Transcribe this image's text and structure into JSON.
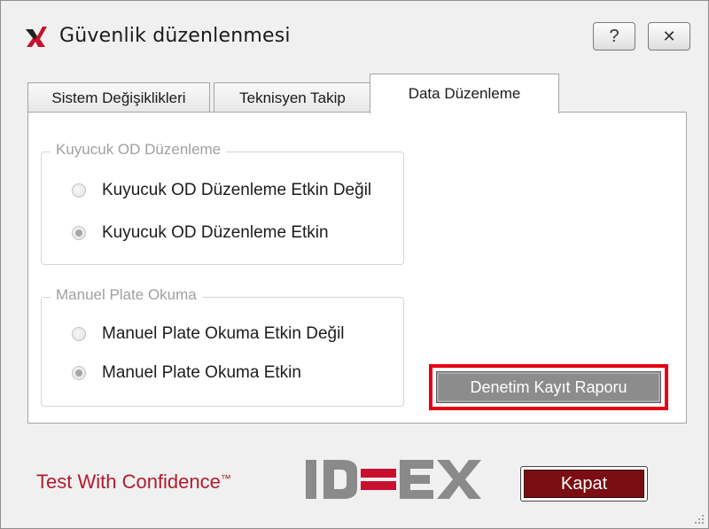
{
  "window": {
    "title": "Güvenlik düzenlenmesi",
    "help_label": "?",
    "close_label": "✕"
  },
  "tabs": [
    {
      "label": "Sistem Değişiklikleri",
      "active": false
    },
    {
      "label": "Teknisyen Takip",
      "active": false
    },
    {
      "label": "Data Düzenleme",
      "active": true
    }
  ],
  "groups": [
    {
      "title": "Kuyucuk OD Düzenleme",
      "options": [
        {
          "label": "Kuyucuk OD Düzenleme Etkin Değil",
          "checked": false
        },
        {
          "label": "Kuyucuk OD Düzenleme Etkin",
          "checked": true
        }
      ]
    },
    {
      "title": "Manuel Plate Okuma",
      "options": [
        {
          "label": "Manuel Plate Okuma Etkin Değil",
          "checked": false
        },
        {
          "label": "Manuel Plate Okuma Etkin",
          "checked": true
        }
      ]
    }
  ],
  "report_button": {
    "label": "Denetim Kayıt Raporu",
    "highlight_color": "#e60012"
  },
  "footer": {
    "tagline": "Test With Confidence",
    "trademark": "™",
    "logo_text": "IDEXX",
    "close_button": "Kapat",
    "brand_color": "#7a0e12"
  }
}
